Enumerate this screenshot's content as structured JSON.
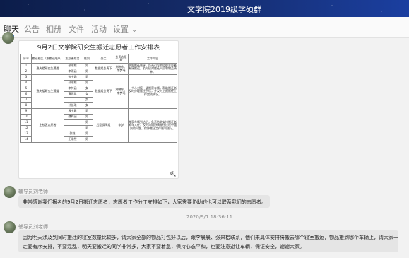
{
  "window": {
    "title": "文学院2019级学硕群"
  },
  "tabs": [
    {
      "label": "聊天",
      "active": true
    },
    {
      "label": "公告"
    },
    {
      "label": "相册"
    },
    {
      "label": "文件"
    },
    {
      "label": "活动"
    },
    {
      "label": "设置 ⌄"
    }
  ],
  "image_message": {
    "doc_title": "9月2日文学院研究生搬迁志愿者工作安排表",
    "headers": [
      "序号",
      "搬迁校区（按搬迁顺序）",
      "志愿者姓名",
      "性别",
      "分工",
      "负责志愿者",
      "工作内容"
    ],
    "rows": [
      [
        "1",
        "",
        "张承煦",
        "男",
        "",
        "",
        ""
      ],
      [
        "2",
        "",
        "李雨涵",
        "男",
        "",
        "",
        ""
      ],
      [
        "3",
        "",
        "张宇涵",
        "男",
        "",
        "",
        ""
      ],
      [
        "4",
        "",
        "孙承煦",
        "男",
        "",
        "",
        ""
      ],
      [
        "5",
        "",
        "李梓涵",
        "女",
        "",
        "",
        ""
      ],
      [
        "6",
        "",
        "曹思琪",
        "女",
        "",
        "",
        ""
      ],
      [
        "7",
        "",
        "",
        "女",
        "",
        "",
        ""
      ],
      [
        "8",
        "",
        "孙佳琪",
        "女",
        "",
        "",
        ""
      ],
      [
        "9",
        "",
        "周宇晨",
        "男",
        "",
        "",
        ""
      ],
      [
        "10",
        "",
        "魏梓涵",
        "男",
        "",
        "",
        ""
      ],
      [
        "11",
        "",
        "",
        "男",
        "",
        "",
        ""
      ],
      [
        "12",
        "",
        "",
        "男",
        "",
        "",
        ""
      ],
      [
        "13",
        "",
        "张铭",
        "男",
        "",
        "",
        ""
      ],
      [
        "14",
        "",
        "王承煦",
        "男",
        "",
        "",
        ""
      ]
    ],
    "groups": [
      {
        "campus": "逸夫楼研究生通道",
        "role": "数据组负责下",
        "leader": "刘晓东、李梦瑶",
        "duty": "按照搬迁顺序，负责引导和组织志愿者有序搬运，及时核对搬迁人员和物品清单。"
      },
      {
        "campus": "逸夫楼研究生通道",
        "role": "数据组负责下",
        "leader": "刘晓东、李梦瑶",
        "duty": "一个人对接一辆搬家车辆，帮助搬迁者及时办理搬迁手续，并及时上报搬迁工作完成情况。"
      },
      {
        "campus": "主校区志愿者",
        "role": "后勤保障组",
        "leader": "李梦",
        "duty": "搬家车辆到达后，负责协助安排搬迁者卸车入住，及时沟通协调搬迁过程中遇到的问题，保障搬迁工作顺利进行。"
      }
    ],
    "zoom_icon": "zoom-in-icon"
  },
  "messages": [
    {
      "sender": "辅导员刘老师",
      "text": "非常感谢我们报名的9月2日搬迁志愿者，志愿者工作分工安排如下，大家需要协助的也可以联系我们的志愿者。"
    },
    {
      "timestamp": "2020/9/1 18:36:11"
    },
    {
      "sender": "辅导员刘老师",
      "text_line1": "因为明天涉及到同时搬迁的寝室数量比较多，请大家全部的物品打包好以后，跟李晨晨、张来桧联系，他们来具体安排将搬去哪个寝室搬运，物品搬到哪个车辆上，请大家一",
      "text_line2": "定要有序安排，不要混乱，明天要搬迁的同学非常多，大家不要着急，保持心态平和，也要注意避让车辆，保证安全，谢谢大家。"
    }
  ]
}
